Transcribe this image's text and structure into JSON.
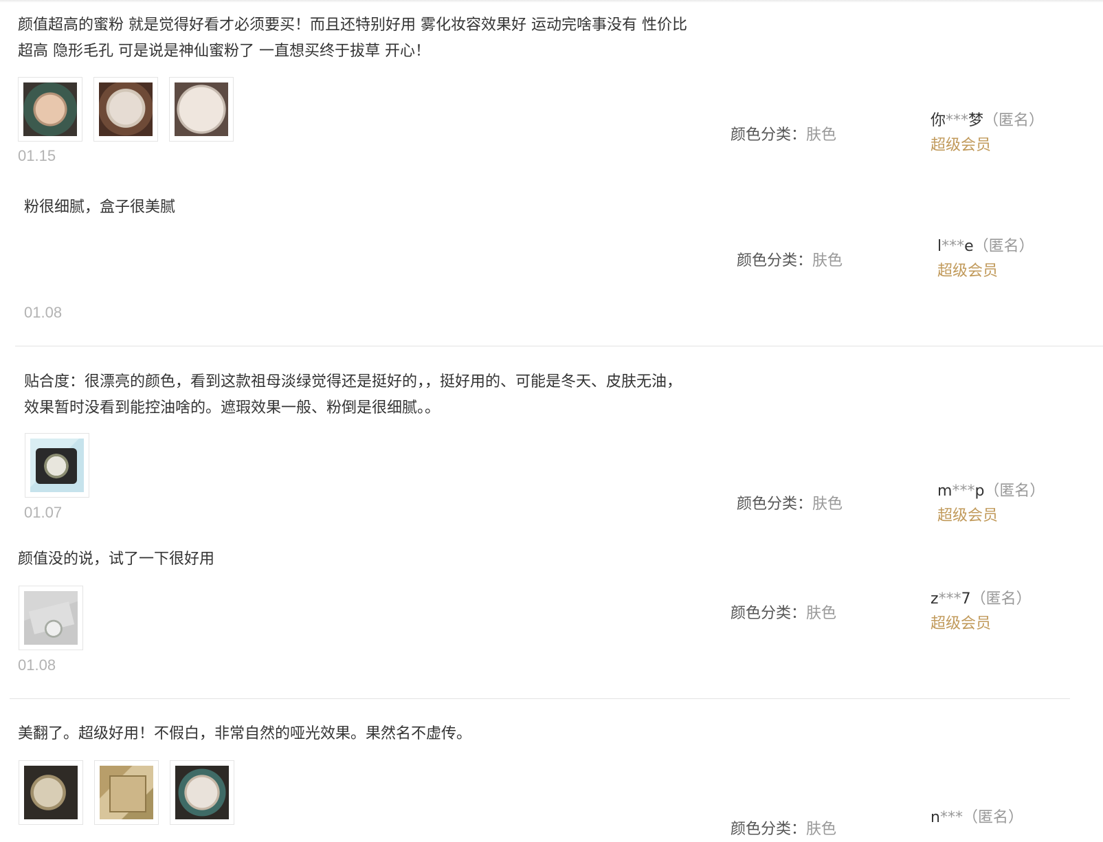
{
  "reviews": [
    {
      "text": "颜值超高的蜜粉 就是觉得好看才必须要买！而且还特别好用 雾化妆容效果好 运动完啥事没有 性价比超高 隐形毛孔 可是说是神仙蜜粉了 一直想买终于拔草 开心！",
      "photos": [
        "review-photo-1",
        "review-photo-2",
        "review-photo-3"
      ],
      "date": "01.15",
      "sku_label": "颜色分类：",
      "sku_value": "肤色",
      "user_prefix": "你",
      "user_mask": "***",
      "user_suffix": "梦",
      "anonymous": "（匿名）",
      "member_level": "超级会员"
    },
    {
      "text": "粉很细腻，盒子很美腻",
      "photos": [],
      "date": "01.08",
      "sku_label": "颜色分类：",
      "sku_value": "肤色",
      "user_prefix": "l",
      "user_mask": "***",
      "user_suffix": "e",
      "anonymous": "（匿名）",
      "member_level": "超级会员"
    },
    {
      "text": "贴合度：很漂亮的颜色，看到这款祖母淡绿觉得还是挺好的，，挺好用的、可能是冬天、皮肤无油，效果暂时没看到能控油啥的。遮瑕效果一般、粉倒是很细腻。。",
      "photos": [
        "review-photo-1"
      ],
      "date": "01.07",
      "sku_label": "颜色分类：",
      "sku_value": "肤色",
      "user_prefix": "m",
      "user_mask": "***",
      "user_suffix": "p",
      "anonymous": "（匿名）",
      "member_level": "超级会员"
    },
    {
      "text": "颜值没的说，试了一下很好用",
      "photos": [
        "review-photo-1"
      ],
      "date": "01.08",
      "sku_label": "颜色分类：",
      "sku_value": "肤色",
      "user_prefix": "z",
      "user_mask": "***",
      "user_suffix": "7",
      "anonymous": "（匿名）",
      "member_level": "超级会员"
    },
    {
      "text": "美翻了。超级好用！不假白，非常自然的哑光效果。果然名不虚传。",
      "photos": [
        "review-photo-1",
        "review-photo-2",
        "review-photo-3"
      ],
      "sku_label": "颜色分类：",
      "sku_value": "肤色",
      "user_prefix": "n",
      "user_mask": "***",
      "user_suffix": "",
      "anonymous": "（匿名）"
    }
  ]
}
